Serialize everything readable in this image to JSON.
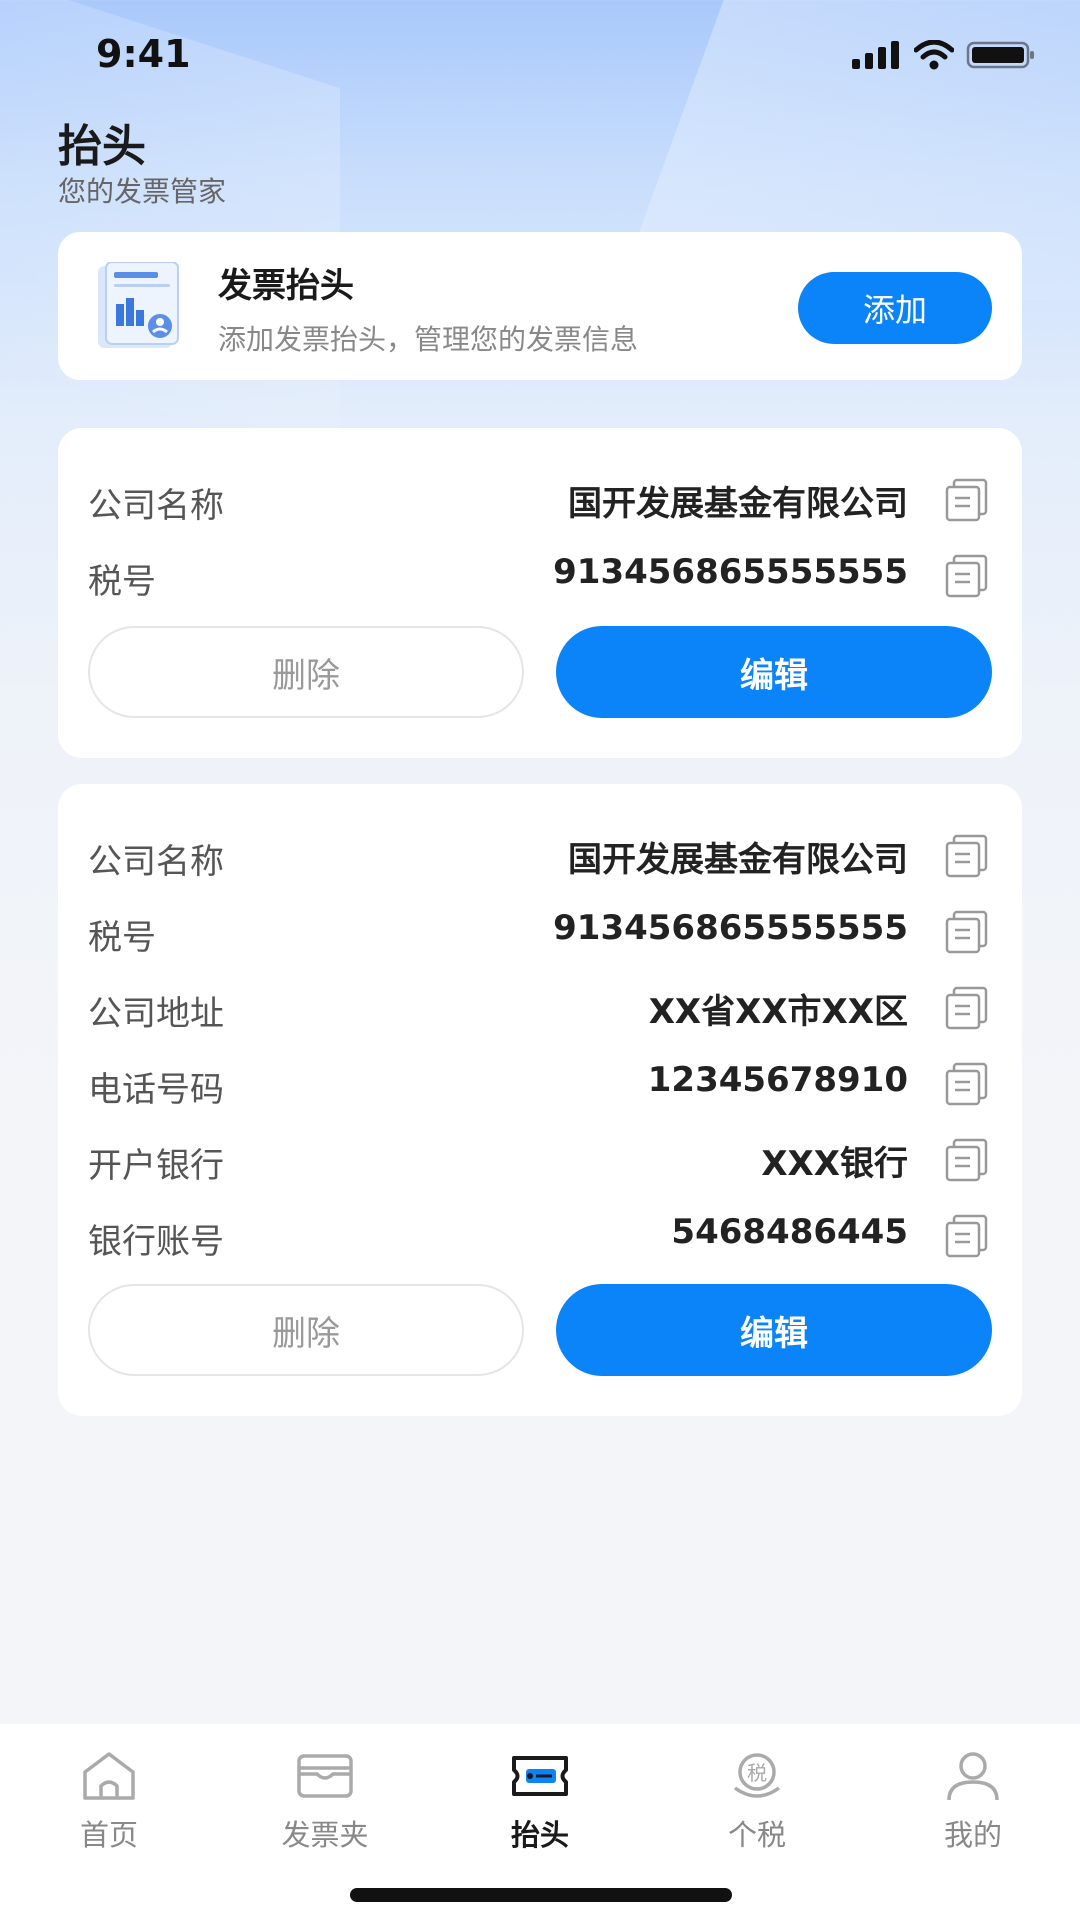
{
  "status_bar": {
    "time": "9:41"
  },
  "header": {
    "title": "抬头",
    "subtitle": "您的发票管家"
  },
  "banner": {
    "icon_name": "invoice-document-icon",
    "title": "发票抬头",
    "description": "添加发票抬头，管理您的发票信息",
    "add_label": "添加"
  },
  "cards": [
    {
      "rows": [
        {
          "label": "公司名称",
          "value": "国开发展基金有限公司"
        },
        {
          "label": "税号",
          "value": "913456865555555"
        }
      ],
      "delete_label": "删除",
      "edit_label": "编辑"
    },
    {
      "rows": [
        {
          "label": "公司名称",
          "value": "国开发展基金有限公司"
        },
        {
          "label": "税号",
          "value": "913456865555555"
        },
        {
          "label": "公司地址",
          "value": "XX省XX市XX区"
        },
        {
          "label": "电话号码",
          "value": "12345678910"
        },
        {
          "label": "开户银行",
          "value": "XXX银行"
        },
        {
          "label": "银行账号",
          "value": "5468486445"
        }
      ],
      "delete_label": "删除",
      "edit_label": "编辑"
    }
  ],
  "tab_bar": {
    "active_index": 2,
    "tabs": [
      {
        "label": "首页",
        "icon": "home-icon"
      },
      {
        "label": "发票夹",
        "icon": "folder-icon"
      },
      {
        "label": "抬头",
        "icon": "ticket-icon"
      },
      {
        "label": "个税",
        "icon": "tax-icon",
        "icon_text": "税"
      },
      {
        "label": "我的",
        "icon": "user-icon"
      }
    ]
  },
  "colors": {
    "accent": "#0a84f8",
    "background": "#f3f5f9"
  }
}
